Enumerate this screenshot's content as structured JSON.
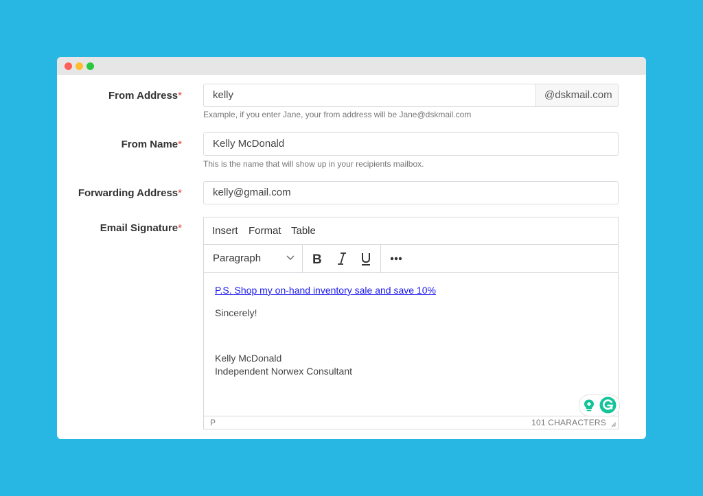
{
  "form": {
    "from_address": {
      "label": "From Address",
      "required": "*",
      "value": "kelly",
      "domain": "@dskmail.com",
      "help": "Example, if you enter Jane, your from address will be Jane@dskmail.com"
    },
    "from_name": {
      "label": "From Name",
      "required": "*",
      "value": "Kelly McDonald",
      "help": "This is the name that will show up in your recipients mailbox."
    },
    "forwarding_address": {
      "label": "Forwarding Address",
      "required": "*",
      "value": "kelly@gmail.com"
    },
    "email_signature": {
      "label": "Email Signature",
      "required": "*"
    }
  },
  "editor": {
    "menu": [
      "Insert",
      "Format",
      "Table"
    ],
    "block_format": "Paragraph",
    "toolbar_icons": [
      "bold-icon",
      "italic-icon",
      "underline-icon",
      "more-icon"
    ],
    "content": {
      "link_text": "P.S. Shop my on-hand inventory sale and save 10%",
      "closing": "Sincerely!",
      "name": "Kelly McDonald",
      "title": "Independent Norwex Consultant"
    },
    "status": {
      "path": "P",
      "char_count": "101 CHARACTERS"
    }
  },
  "colors": {
    "background": "#28b6e3",
    "required": "#e0453a",
    "link": "#1a1aee",
    "grammarly": "#15c39a"
  }
}
